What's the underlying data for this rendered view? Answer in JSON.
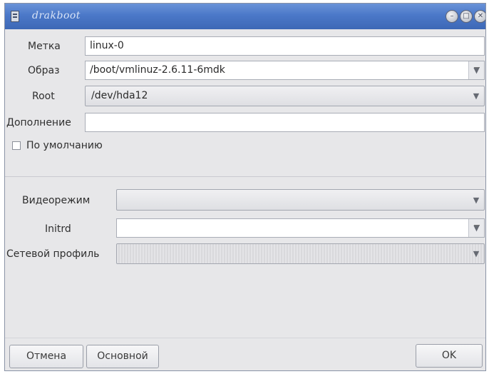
{
  "window": {
    "title": "drakboot"
  },
  "form": {
    "label": {
      "label": "Метка",
      "value": "linux-0"
    },
    "image": {
      "label": "Образ",
      "value": "/boot/vmlinuz-2.6.11-6mdk"
    },
    "root": {
      "label": "Root",
      "value": "/dev/hda12"
    },
    "append": {
      "label": "Дополнение",
      "value": ""
    },
    "default": {
      "label": "По умолчанию",
      "checked": false
    },
    "video": {
      "label": "Видеорежим",
      "value": ""
    },
    "initrd": {
      "label": "Initrd",
      "value": ""
    },
    "network_profile": {
      "label": "Сетевой профиль",
      "value": ""
    }
  },
  "buttons": {
    "cancel": "Отмена",
    "basic": "Основной",
    "ok": "OK"
  },
  "icons": {
    "minimize": "minimize-icon",
    "maximize": "maximize-icon",
    "close": "close-icon",
    "dropdown": "chevron-down-icon"
  }
}
